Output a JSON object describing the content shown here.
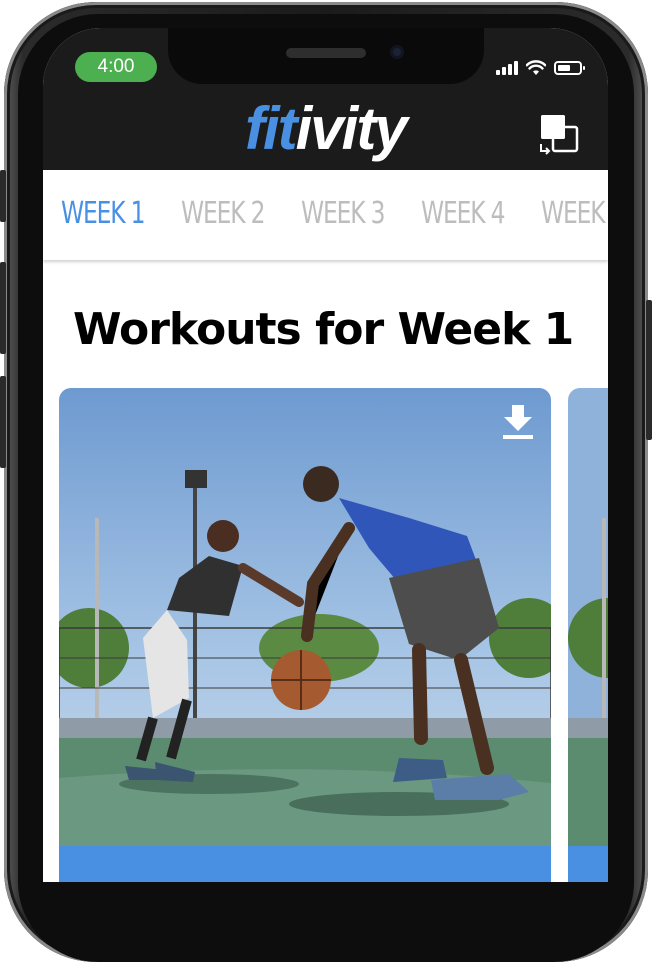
{
  "status_bar": {
    "time": "4:00"
  },
  "app": {
    "logo_part1": "fit",
    "logo_part2": "ivity"
  },
  "tabs": [
    {
      "label": "WEEK 1",
      "active": true
    },
    {
      "label": "WEEK 2",
      "active": false
    },
    {
      "label": "WEEK 3",
      "active": false
    },
    {
      "label": "WEEK 4",
      "active": false
    },
    {
      "label": "WEEK",
      "active": false
    }
  ],
  "main": {
    "heading": "Workouts for Week 1"
  },
  "colors": {
    "accent": "#4a90e2",
    "status_green": "#4caf50",
    "tab_inactive": "#bdbdbd",
    "header_bg": "#1b1b1b"
  },
  "icons": {
    "cast": "cast-icon",
    "download": "download-icon",
    "wifi": "wifi-icon",
    "battery": "battery-icon",
    "signal": "signal-icon"
  }
}
